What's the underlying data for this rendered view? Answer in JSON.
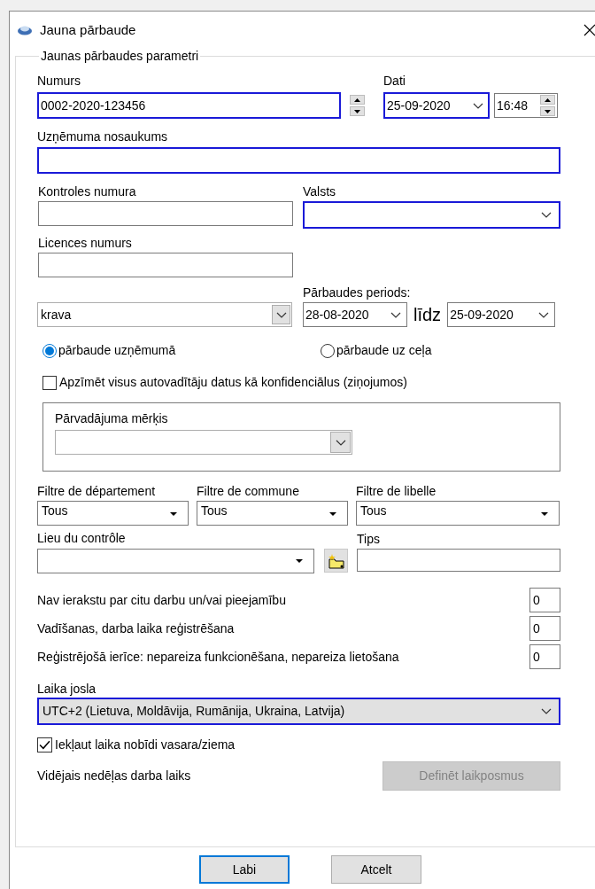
{
  "window": {
    "title": "Jauna pārbaude"
  },
  "legend": "Jaunas pārbaudes parametri",
  "numurs": {
    "label": "Numurs",
    "value": "0002-2020-123456",
    "highlighted": true
  },
  "dati": {
    "label": "Dati",
    "date": "25-09-2020",
    "time": "16:48",
    "highlighted": true
  },
  "company": {
    "label": "Uzņēmuma nosaukums",
    "highlighted": true
  },
  "control_number": {
    "label": "Kontroles numura",
    "highlighted": false
  },
  "country": {
    "label": "Valsts",
    "highlighted": true
  },
  "licence": {
    "label": "Licences numurs",
    "highlighted": false
  },
  "cargo": {
    "value": "krava"
  },
  "period": {
    "label": "Pārbaudes periods:",
    "from": "28-08-2020",
    "separator": "līdz",
    "to": "25-09-2020"
  },
  "location_radios": [
    {
      "label": "pārbaude uzņēmumā",
      "selected": true
    },
    {
      "label": "pārbaude uz ceļa",
      "selected": false
    }
  ],
  "confidential": {
    "label": "Apzīmēt visus autovadītāju datus kā konfidenciālus (ziņojumos)",
    "checked": false
  },
  "purpose": {
    "label": "Pārvadājuma mērķis"
  },
  "filters": [
    {
      "label": "Filtre de département",
      "value": "Tous"
    },
    {
      "label": "Filtre de commune",
      "value": "Tous"
    },
    {
      "label": "Filtre de libelle",
      "value": "Tous"
    }
  ],
  "place": {
    "label": "Lieu du contrôle"
  },
  "tips": {
    "label": "Tips"
  },
  "counters": [
    {
      "label": "Nav ierakstu par citu darbu un/vai pieejamību",
      "value": "0"
    },
    {
      "label": "Vadīšanas, darba laika reģistrēšana",
      "value": "0"
    },
    {
      "label": "Reģistrējošā ierīce: nepareiza funkcionēšana, nepareiza lietošana",
      "value": "0"
    }
  ],
  "timezone": {
    "label": "Laika josla",
    "value": "UTC+2 (Lietuva, Moldāvija, Rumānija, Ukraina, Latvija)",
    "highlighted": true
  },
  "dst": {
    "label": "Iekļaut laika nobīdi vasara/ziema",
    "checked": true
  },
  "weekly": {
    "label": "Vidējais nedēļas darba laiks",
    "button": "Definēt laikposmus",
    "button_disabled": true
  },
  "buttons": [
    {
      "label": "Labi",
      "default": true
    },
    {
      "label": "Atcelt",
      "default": false
    }
  ]
}
